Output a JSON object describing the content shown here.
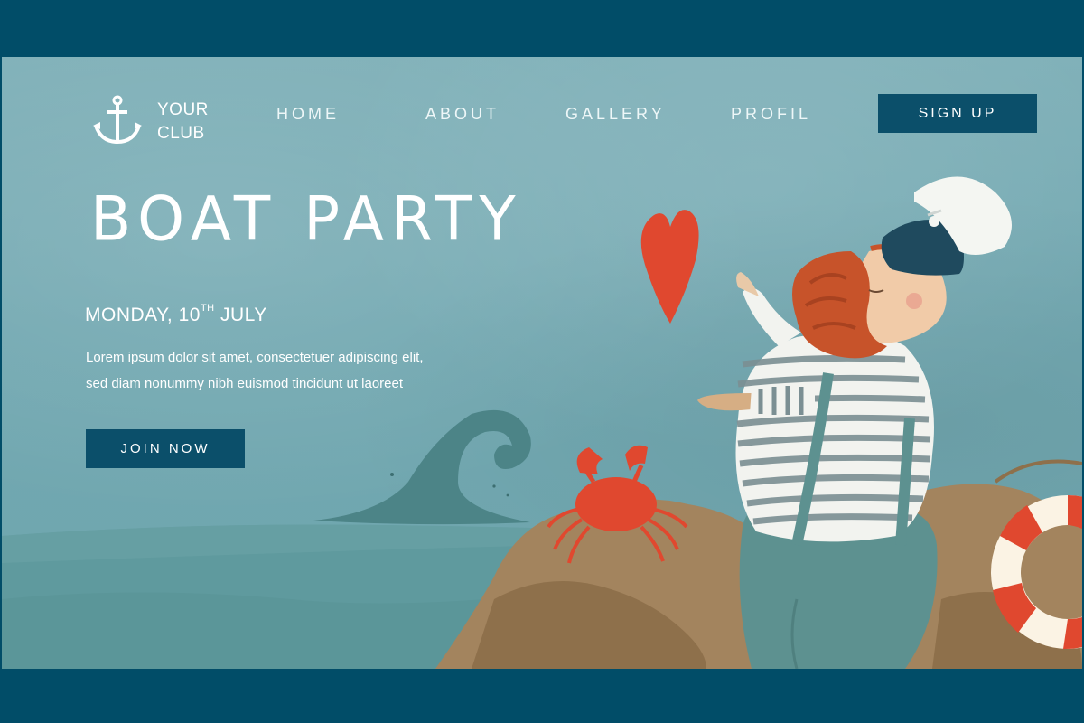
{
  "brand": {
    "logo_icon": "anchor-icon",
    "line1": "YOUR",
    "line2": "CLUB"
  },
  "nav": {
    "items": [
      {
        "label": "HOME"
      },
      {
        "label": "ABOUT"
      },
      {
        "label": "GALLERY"
      },
      {
        "label": "PROFIL"
      }
    ],
    "signup_label": "SIGN UP"
  },
  "hero": {
    "title": "BOAT PARTY",
    "date_prefix": "MONDAY, 10",
    "date_sup": "TH",
    "date_suffix": " JULY",
    "desc_line1": "Lorem ipsum dolor sit amet, consectetuer adipiscing elit,",
    "desc_line2": "sed diam nonummy nibh euismod tincidunt ut laoreet",
    "cta_label": "JOIN NOW"
  },
  "colors": {
    "frame": "#014d68",
    "sky": "#72a8b1",
    "button": "#0b4f6a",
    "accent_red": "#e0482f"
  },
  "illustration": {
    "elements": [
      "heart-icon",
      "sailor",
      "crab",
      "wave",
      "rocks",
      "life-buoy"
    ]
  }
}
